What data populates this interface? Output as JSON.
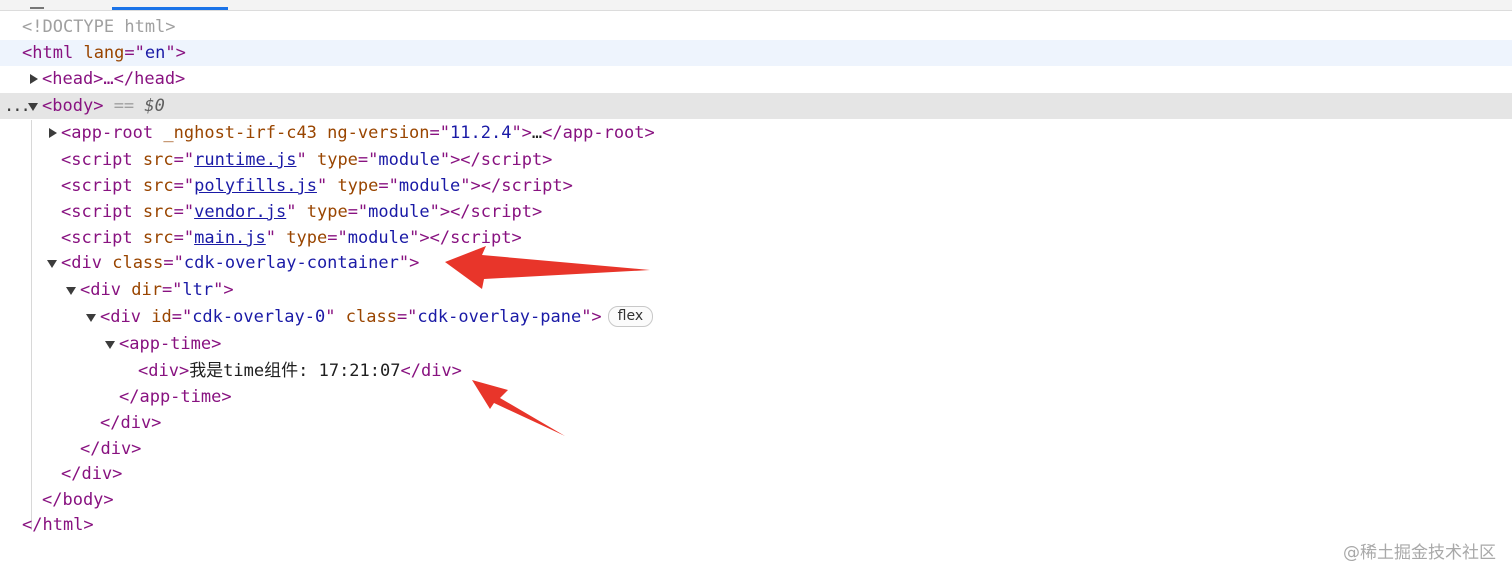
{
  "devtools": {
    "doctype": "<!DOCTYPE html>",
    "html_open": {
      "tag": "html",
      "attr": "lang",
      "value": "en"
    },
    "head": {
      "text": "<head>…</head>"
    },
    "body": {
      "tag": "body",
      "eq": " == ",
      "ref": "$0",
      "dots": "..."
    },
    "app_root": {
      "tag": "app-root",
      "attr1": "_nghost-irf-c43",
      "attr2": "ng-version",
      "attr2_value": "11.2.4",
      "ellipsis": "…",
      "close": "</app-root>"
    },
    "scripts": [
      {
        "src": "runtime.js",
        "type": "module"
      },
      {
        "src": "polyfills.js",
        "type": "module"
      },
      {
        "src": "vendor.js",
        "type": "module"
      },
      {
        "src": "main.js",
        "type": "module"
      }
    ],
    "overlay_container": {
      "tag": "div",
      "attr": "class",
      "value": "cdk-overlay-container"
    },
    "dir_div": {
      "tag": "div",
      "attr": "dir",
      "value": "ltr"
    },
    "pane_div": {
      "tag": "div",
      "attr1": "id",
      "value1": "cdk-overlay-0",
      "attr2": "class",
      "value2": "cdk-overlay-pane",
      "badge": "flex"
    },
    "app_time_open": "<app-time>",
    "time_div": {
      "open": "<div>",
      "text": "我是time组件: 17:21:07",
      "close": "</div>"
    },
    "app_time_close": "</app-time>",
    "closes": [
      "</div>",
      "</div>",
      "</div>",
      "</body>",
      "</html>"
    ]
  },
  "watermark": "@稀土掘金技术社区",
  "colors": {
    "tag": "#881280",
    "attr": "#994500",
    "value": "#1a1aa6",
    "arrow": "#e8352a",
    "selection": "#e5e5e5"
  }
}
